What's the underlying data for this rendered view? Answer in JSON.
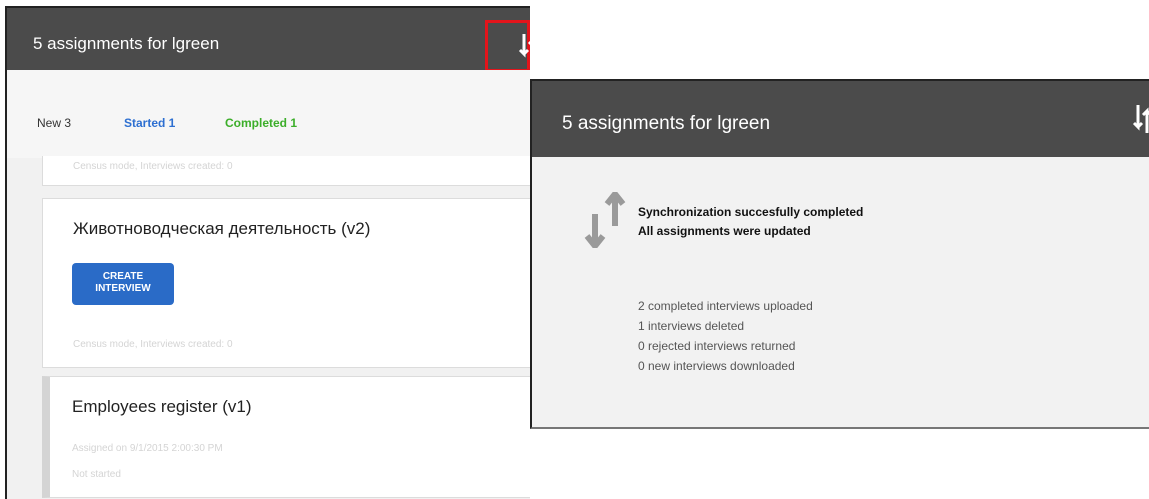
{
  "left": {
    "title": "5 assignments for lgreen",
    "tabs": {
      "new": "New 3",
      "started": "Started 1",
      "completed": "Completed 1"
    },
    "cards": [
      {
        "meta": "Census mode, Interviews created: 0"
      },
      {
        "title": "Животноводческая деятельность (v2)",
        "button_line1": "CREATE",
        "button_line2": "INTERVIEW",
        "meta": "Census mode, Interviews created: 0"
      },
      {
        "title": "Employees register (v1)",
        "assigned": "Assigned on 9/1/2015 2:00:30 PM",
        "status": "Not started"
      }
    ]
  },
  "right": {
    "title": "5 assignments for lgreen",
    "status_line1": "Synchronization succesfully completed",
    "status_line2": "All assignments were updated",
    "stats": [
      "2 completed interviews uploaded",
      "1 interviews deleted",
      "0 rejected interviews returned",
      "0 new interviews downloaded"
    ]
  },
  "icons": {
    "sync": "sync-arrows-icon"
  },
  "colors": {
    "header": "#4b4b4b",
    "started_tab": "#2d6fd1",
    "completed_tab": "#3cae2a",
    "button": "#2a6bc7",
    "highlight": "#e3141b"
  }
}
